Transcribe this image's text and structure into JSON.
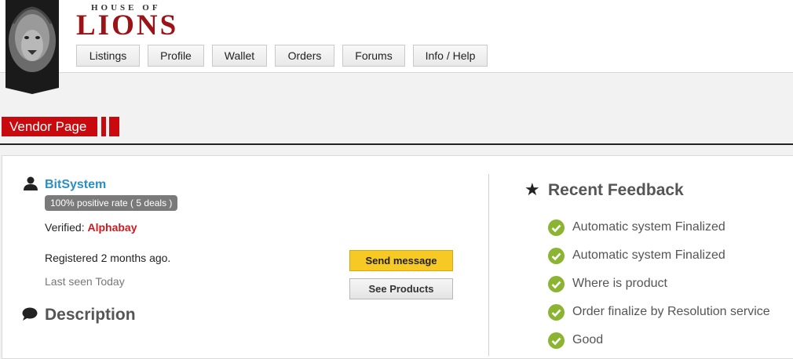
{
  "brand": {
    "sub": "HOUSE OF",
    "main": "LIONS"
  },
  "nav": [
    "Listings",
    "Profile",
    "Wallet",
    "Orders",
    "Forums",
    "Info / Help"
  ],
  "page_tab": "Vendor Page",
  "vendor": {
    "name": "BitSystem",
    "rate": "100% positive rate ( 5 deals )",
    "verified_label": "Verified:",
    "verified_value": "Alphabay",
    "registered": "Registered 2 months ago.",
    "last_seen": "Last seen Today",
    "send_message": "Send message",
    "see_products": "See Products",
    "description_title": "Description"
  },
  "feedback": {
    "title": "Recent Feedback",
    "items": [
      "Automatic system Finalized",
      "Automatic system Finalized",
      "Where is product",
      "Order finalize by Resolution service",
      "Good"
    ]
  },
  "colors": {
    "brand": "#9b1318",
    "tab": "#c8090d",
    "link": "#2a8fc1",
    "check": "#8bb433",
    "send": "#f7c925"
  }
}
